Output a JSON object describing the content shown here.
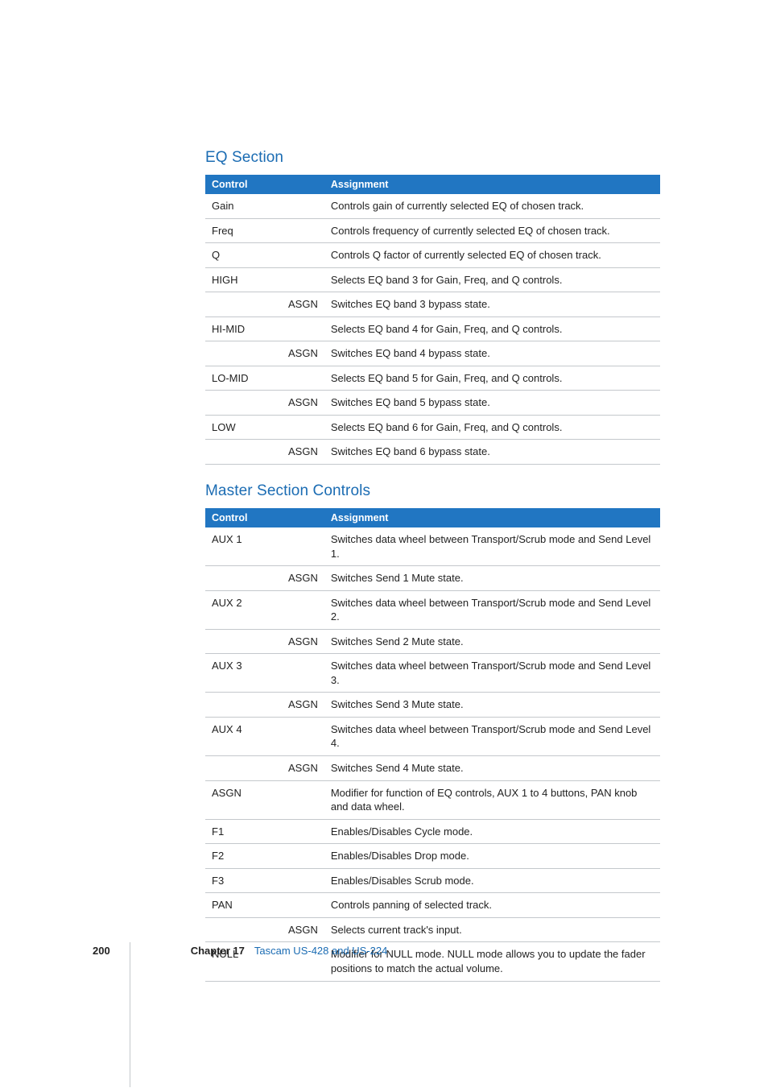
{
  "section1": {
    "title": "EQ Section"
  },
  "section2": {
    "title": "Master Section Controls"
  },
  "headers": {
    "control": "Control",
    "assignment": "Assignment"
  },
  "eq": [
    {
      "c": "Gain",
      "m": "",
      "a": "Controls gain of currently selected EQ of chosen track."
    },
    {
      "c": "Freq",
      "m": "",
      "a": "Controls frequency of currently selected EQ of chosen track."
    },
    {
      "c": "Q",
      "m": "",
      "a": "Controls Q factor of currently selected EQ of chosen track."
    },
    {
      "c": "HIGH",
      "m": "",
      "a": "Selects EQ band 3 for Gain, Freq, and Q controls."
    },
    {
      "c": "",
      "m": "ASGN",
      "a": "Switches EQ band 3 bypass state."
    },
    {
      "c": "HI-MID",
      "m": "",
      "a": "Selects EQ band 4 for Gain, Freq, and Q controls."
    },
    {
      "c": "",
      "m": "ASGN",
      "a": "Switches EQ band 4 bypass state."
    },
    {
      "c": "LO-MID",
      "m": "",
      "a": "Selects EQ band 5 for Gain, Freq, and Q controls."
    },
    {
      "c": "",
      "m": "ASGN",
      "a": "Switches EQ band 5 bypass state."
    },
    {
      "c": "LOW",
      "m": "",
      "a": "Selects EQ band 6 for Gain, Freq, and Q controls."
    },
    {
      "c": "",
      "m": "ASGN",
      "a": "Switches EQ band 6 bypass state."
    }
  ],
  "master": [
    {
      "c": "AUX 1",
      "m": "",
      "a": "Switches data wheel between Transport/Scrub mode and Send Level 1."
    },
    {
      "c": "",
      "m": "ASGN",
      "a": "Switches Send 1 Mute state."
    },
    {
      "c": "AUX 2",
      "m": "",
      "a": "Switches data wheel between Transport/Scrub mode and Send Level 2."
    },
    {
      "c": "",
      "m": "ASGN",
      "a": "Switches Send 2 Mute state."
    },
    {
      "c": "AUX 3",
      "m": "",
      "a": "Switches data wheel between Transport/Scrub mode and Send Level 3."
    },
    {
      "c": "",
      "m": "ASGN",
      "a": "Switches Send 3 Mute state."
    },
    {
      "c": "AUX 4",
      "m": "",
      "a": "Switches data wheel between Transport/Scrub mode and Send Level 4."
    },
    {
      "c": "",
      "m": "ASGN",
      "a": "Switches Send 4 Mute state."
    },
    {
      "c": "ASGN",
      "m": "",
      "a": "Modifier for function of EQ controls, AUX 1 to 4 buttons, PAN knob and data wheel."
    },
    {
      "c": "F1",
      "m": "",
      "a": "Enables/Disables Cycle mode."
    },
    {
      "c": "F2",
      "m": "",
      "a": "Enables/Disables Drop mode."
    },
    {
      "c": "F3",
      "m": "",
      "a": "Enables/Disables Scrub mode."
    },
    {
      "c": "PAN",
      "m": "",
      "a": "Controls panning of selected track."
    },
    {
      "c": "",
      "m": "ASGN",
      "a": "Selects current track's input."
    },
    {
      "c": "NULL",
      "m": "",
      "a": "Modifier for NULL mode. NULL mode allows you to update the fader positions to match the actual volume."
    }
  ],
  "footer": {
    "page": "200",
    "chapterLabel": "Chapter 17",
    "chapterTitle": "Tascam US-428 and US-224"
  }
}
